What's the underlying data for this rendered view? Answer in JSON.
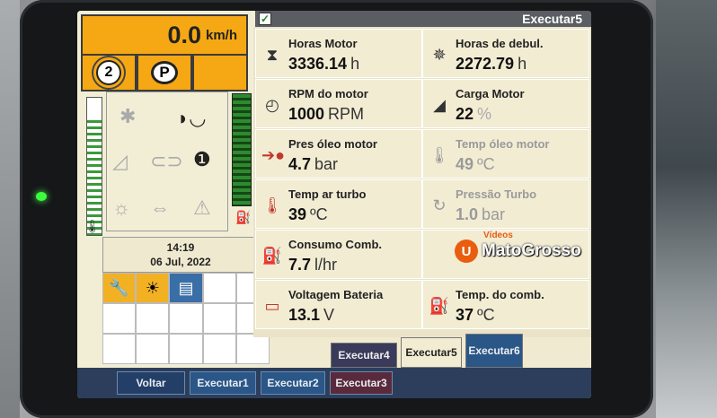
{
  "window": {
    "title": "Executar5"
  },
  "speed": {
    "value": "0.0",
    "unit": "km/h"
  },
  "gear": {
    "number": "2",
    "park": "P"
  },
  "clock": {
    "time": "14:19",
    "date": "06 Jul, 2022"
  },
  "params": [
    {
      "label": "Horas Motor",
      "value": "3336.14",
      "unit": "h",
      "icon": "hourglass-icon",
      "faded": false
    },
    {
      "label": "Horas de debul.",
      "value": "2272.79",
      "unit": "h",
      "icon": "thresher-rotor-icon",
      "faded": false
    },
    {
      "label": "RPM do motor",
      "value": "1000",
      "unit": "RPM",
      "icon": "engine-rpm-icon",
      "faded": false
    },
    {
      "label": "Carga Motor",
      "value": "22",
      "unit": "%",
      "icon": "engine-load-icon",
      "faded": false
    },
    {
      "label": "Pres óleo motor",
      "value": "4.7",
      "unit": "bar",
      "icon": "oil-pressure-icon",
      "faded": false
    },
    {
      "label": "Temp óleo motor",
      "value": "49",
      "unit": "ºC",
      "icon": "oil-temperature-icon",
      "faded": true
    },
    {
      "label": "Temp ar turbo",
      "value": "39",
      "unit": "ºC",
      "icon": "turbo-air-temperature-icon",
      "faded": false
    },
    {
      "label": "Pressão Turbo",
      "value": "1.0",
      "unit": "bar",
      "icon": "turbo-pressure-icon",
      "faded": true
    },
    {
      "label": "Consumo Comb.",
      "value": "7.7",
      "unit": "l/hr",
      "icon": "fuel-consumption-icon",
      "faded": false
    },
    {
      "label": "Voltagem Bateria",
      "value": "13.1",
      "unit": "V",
      "icon": "battery-icon",
      "faded": false
    },
    {
      "label": "Temp. do comb.",
      "value": "37",
      "unit": "ºC",
      "icon": "fuel-temperature-icon",
      "faded": false
    }
  ],
  "watermark": {
    "small": "Vídeos",
    "main": "MatoGrosso"
  },
  "upper_tabs": [
    "Executar4",
    "Executar5",
    "Executar6"
  ],
  "bottom_tabs": [
    "Voltar",
    "Executar1",
    "Executar2",
    "Executar3"
  ],
  "colors": {
    "accent": "#f5a814",
    "tab": "#2a5688",
    "panel": "#f2ecd3"
  }
}
